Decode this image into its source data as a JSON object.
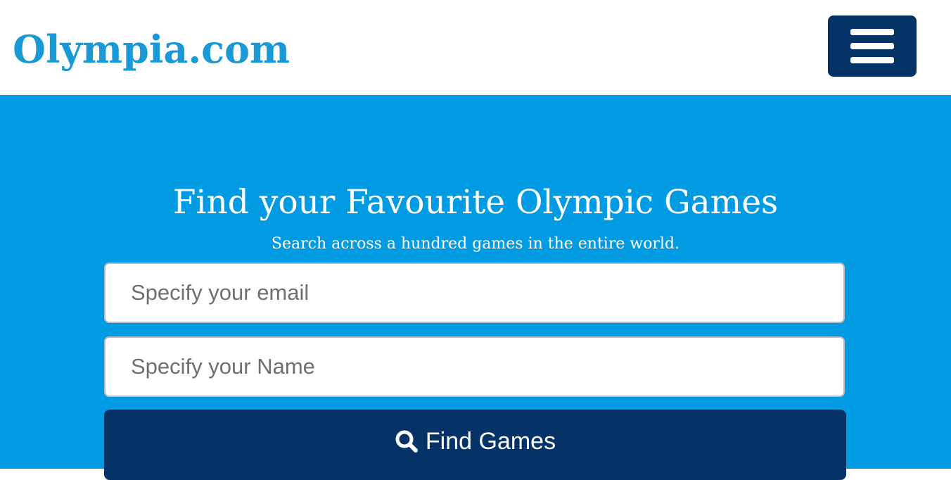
{
  "header": {
    "logo_text": "Olympia.com",
    "menu_icon": "hamburger-menu-icon"
  },
  "hero": {
    "title": "Find your Favourite Olympic Games",
    "subtitle": "Search across a hundred games in the entire world."
  },
  "form": {
    "email_placeholder": "Specify your email",
    "name_placeholder": "Specify your Name",
    "submit_label": "Find Games",
    "submit_icon": "search-icon"
  },
  "colors": {
    "brand_text": "#199ad6",
    "hero_background": "#009be3",
    "navy": "#053368"
  }
}
